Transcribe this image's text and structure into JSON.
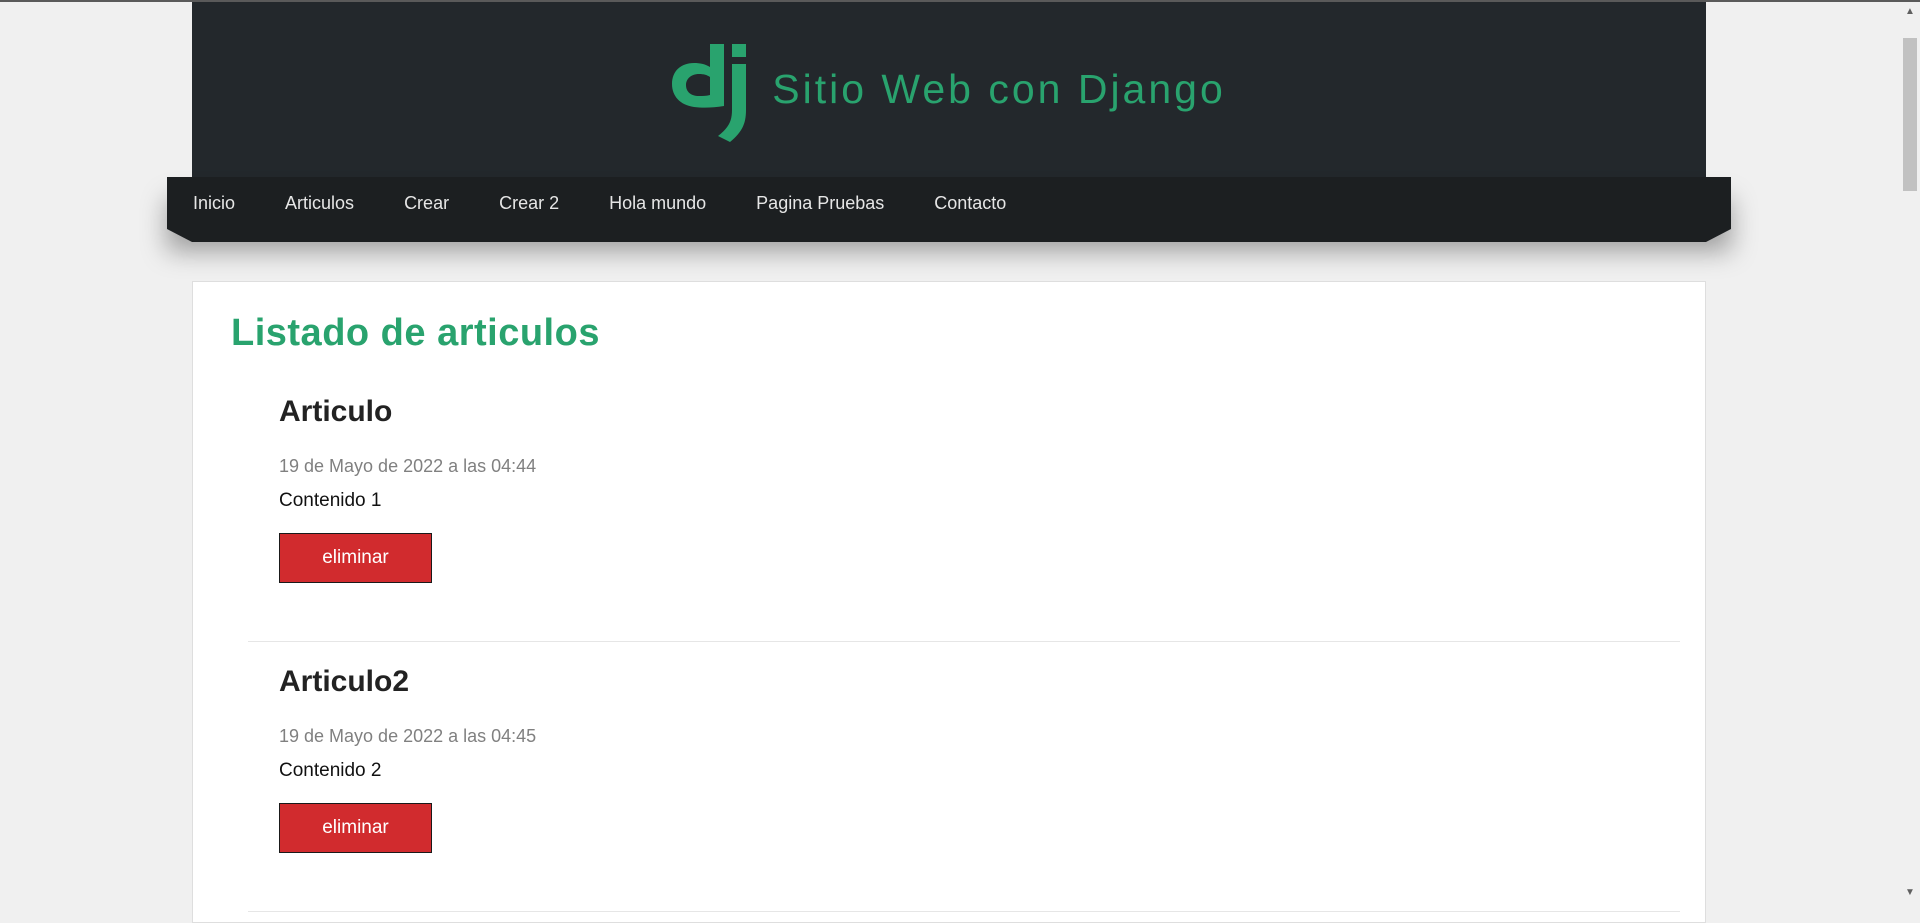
{
  "header": {
    "site_title": "Sitio Web con Django",
    "logo_text": "dj",
    "brand_color": "#29a36e",
    "logo_icon": "django-logo-icon"
  },
  "nav": {
    "items": [
      {
        "label": "Inicio"
      },
      {
        "label": "Articulos"
      },
      {
        "label": "Crear"
      },
      {
        "label": "Crear 2"
      },
      {
        "label": "Hola mundo"
      },
      {
        "label": "Pagina Pruebas"
      },
      {
        "label": "Contacto"
      }
    ]
  },
  "main": {
    "title": "Listado de articulos",
    "articles": [
      {
        "title": "Articulo",
        "date": "19 de Mayo de 2022 a las 04:44",
        "content": "Contenido 1",
        "delete_label": "eliminar"
      },
      {
        "title": "Articulo2",
        "date": "19 de Mayo de 2022 a las 04:45",
        "content": "Contenido 2",
        "delete_label": "eliminar"
      }
    ]
  },
  "colors": {
    "header_bg": "#23282c",
    "nav_bg": "#1c1f21",
    "delete_button": "#d12b2e"
  },
  "scrollbar": {
    "up_icon": "arrow-up-icon",
    "down_icon": "arrow-down-icon"
  }
}
